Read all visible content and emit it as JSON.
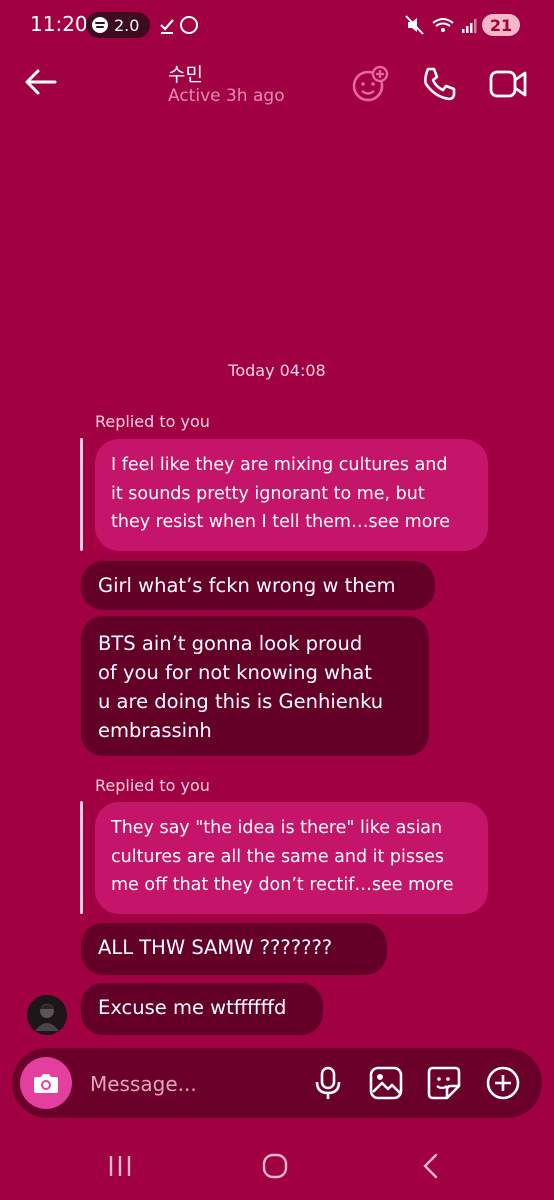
{
  "status_bar": {
    "time": "11:20",
    "spotify_label": "2.0",
    "battery": "21"
  },
  "header": {
    "name": "수민",
    "status": "Active 3h ago"
  },
  "chat": {
    "timestamp": "Today 04:08",
    "replied_label_1": "Replied to you",
    "reply_1_lines": [
      "I feel like they are mixing cultures and",
      "it sounds pretty ignorant to me, but",
      "they resist when I tell them…see more"
    ],
    "msg_1": "Girl what’s fckn wrong w them",
    "msg_2_lines": [
      "BTS ain’t gonna look proud",
      "of you for not knowing what",
      "u are doing this is Genhienku",
      "embrassinh"
    ],
    "replied_label_2": "Replied to you",
    "reply_2_lines": [
      "They say \"the idea is there\" like asian",
      "cultures are all the same and it pisses",
      "me off that they don’t rectif…see more"
    ],
    "msg_3": "ALL THW SAMW ???????",
    "msg_4": "Excuse me wtffffffd"
  },
  "composer": {
    "placeholder": "Message..."
  },
  "colors": {
    "background": "#a10042",
    "reply_bubble": "#c5156b",
    "message_bubble": "#640028",
    "camera_button": "#e33f9f"
  },
  "icons": {
    "back": "arrow-left-icon",
    "effects": "face-plus-icon",
    "call": "phone-icon",
    "video": "video-camera-icon",
    "camera": "camera-icon",
    "mic": "microphone-icon",
    "gallery": "image-icon",
    "sticker": "sticker-icon",
    "more": "plus-circle-icon"
  }
}
